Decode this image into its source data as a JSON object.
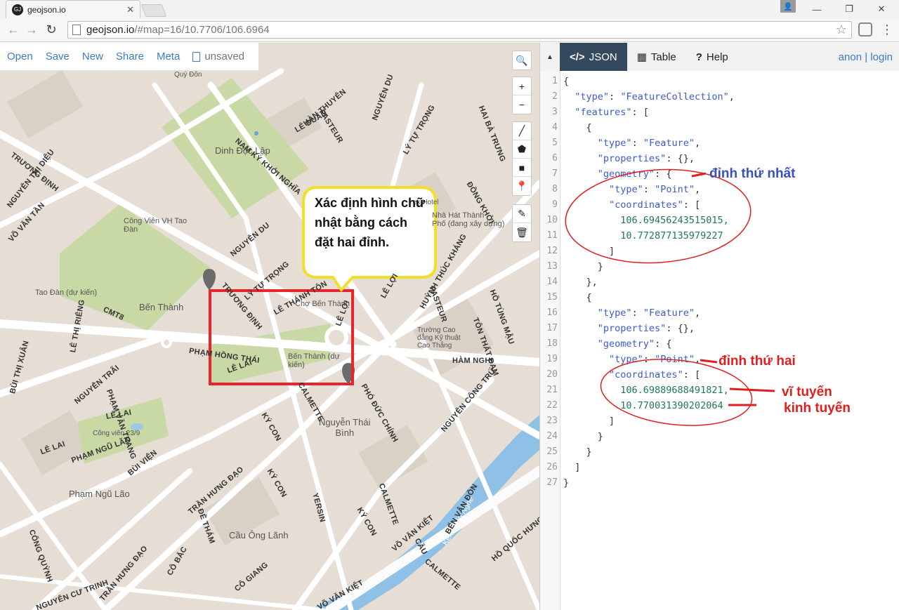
{
  "browser": {
    "tab_title": "geojson.io",
    "favicon_text": "GJ",
    "url_host": "geojson.io",
    "url_path": "/#map=16/10.7706/106.6964"
  },
  "toolbar": {
    "open": "Open",
    "save": "Save",
    "new": "New",
    "share": "Share",
    "meta": "Meta",
    "status": "unsaved"
  },
  "map_labels": {
    "palace": "Dinh Độc Lập",
    "park_vh": "Công Viên VH Tao\nĐàn",
    "tao_dan": "Tao Đàn (dự kiến)",
    "ben_thanh": "Bến Thành",
    "cho_ben_thanh": "Chợ Bến Thành",
    "ben_thanh_station": "Bến Thành (dự\nkiến)",
    "nguyen_thai_binh": "Nguyễn Thái\nBình",
    "pham_ngu_lao": "Phạm Ngũ Lão",
    "cau_ong_lanh": "Cầu Ông Lãnh",
    "cong_vien_23_9": "Công viên 23/9",
    "nha_hat": "Nhà Hát Thành\nPhố (đang xây dựng)",
    "truong_cao_dang": "Trường Cao\nđẳng Kỹ thuật\nCao Thắng",
    "ex_hotel": "ex Hotel",
    "quy_don": "Quý Đôn",
    "kenh": "Kênh Bến Nghé",
    "streets": [
      "NAM KỲ KHỞI NGHĨA",
      "LÊ DUẨN",
      "TRƯƠNG ĐỊNH",
      "NGUYỄN THỊ DIỆU",
      "VÕ VĂN TẦN",
      "NGUYỄN DU",
      "LÝ TỰ TRỌNG",
      "PASTEUR",
      "HÀN THUYÊN",
      "NGUYỄN DU",
      "LÝ TỰ TRỌNG",
      "HAI BÀ TRƯNG",
      "ĐỒNG KHỞI",
      "CMT8",
      "TRƯƠNG ĐỊNH",
      "LÊ THÁNH TÔN",
      "LÊ LỢI",
      "LÊ LỢI",
      "PASTEUR",
      "HUỲNH THÚC KHÁNG",
      "HỒ TÙNG MẬU",
      "TÔN THẤT ĐẠM",
      "PHẠM HỒNG THÁI",
      "LÊ LAI",
      "LÊ THỊ RIÊNG",
      "HÀM NGHI",
      "BÙI THỊ XUÂN",
      "NGUYỄN TRÃI",
      "PHẠM VĂN TRANG",
      "LÊ LAI",
      "LÊ LAI",
      "CALMETTE",
      "PHÓ ĐỨC CHÍNH",
      "NGUYỄN CÔNG TRỨ",
      "KÝ CON",
      "PHẠM NGŨ LÃO",
      "BÙI VIỆN",
      "TRẦN HƯNG ĐẠO",
      "ĐỀ THÁM",
      "KÝ CON",
      "YERSIN",
      "KÝ CON",
      "CALMETTE",
      "VÕ VĂN KIỆT",
      "BẾN VÂN ĐỒN",
      "CỐNG QUỲNH",
      "NGUYỄN CƯ TRINH",
      "TRẦN HƯNG ĐẠO",
      "CÔ BẮC",
      "CÔ GIANG",
      "CALMETTE",
      "HỒ QUỐC HƯNG",
      "VÕ VĂN KIỆT",
      "CẦU"
    ]
  },
  "annotation": {
    "bubble": "Xác định hình chữ nhật bằng cách đặt hai đỉnh.",
    "vertex1": "đỉnh thứ nhất",
    "vertex2": "đỉnh thứ hai",
    "lat": "vĩ tuyến",
    "lon": "kinh tuyến"
  },
  "panel": {
    "tabs": [
      "JSON",
      "Table",
      "Help"
    ],
    "auth_anon": "anon",
    "auth_sep": "|",
    "auth_login": "login"
  },
  "code_lines": [
    "{",
    "  \"type\": \"FeatureCollection\",",
    "  \"features\": [",
    "    {",
    "      \"type\": \"Feature\",",
    "      \"properties\": {},",
    "      \"geometry\": {",
    "        \"type\": \"Point\",",
    "        \"coordinates\": [",
    "          106.69456243515015,",
    "          10.772877135979227",
    "        ]",
    "      }",
    "    },",
    "    {",
    "      \"type\": \"Feature\",",
    "      \"properties\": {},",
    "      \"geometry\": {",
    "        \"type\": \"Point\",",
    "        \"coordinates\": [",
    "          106.69889688491821,",
    "          10.770031390202064",
    "        ]",
    "      }",
    "    }",
    "  ]",
    "}"
  ]
}
